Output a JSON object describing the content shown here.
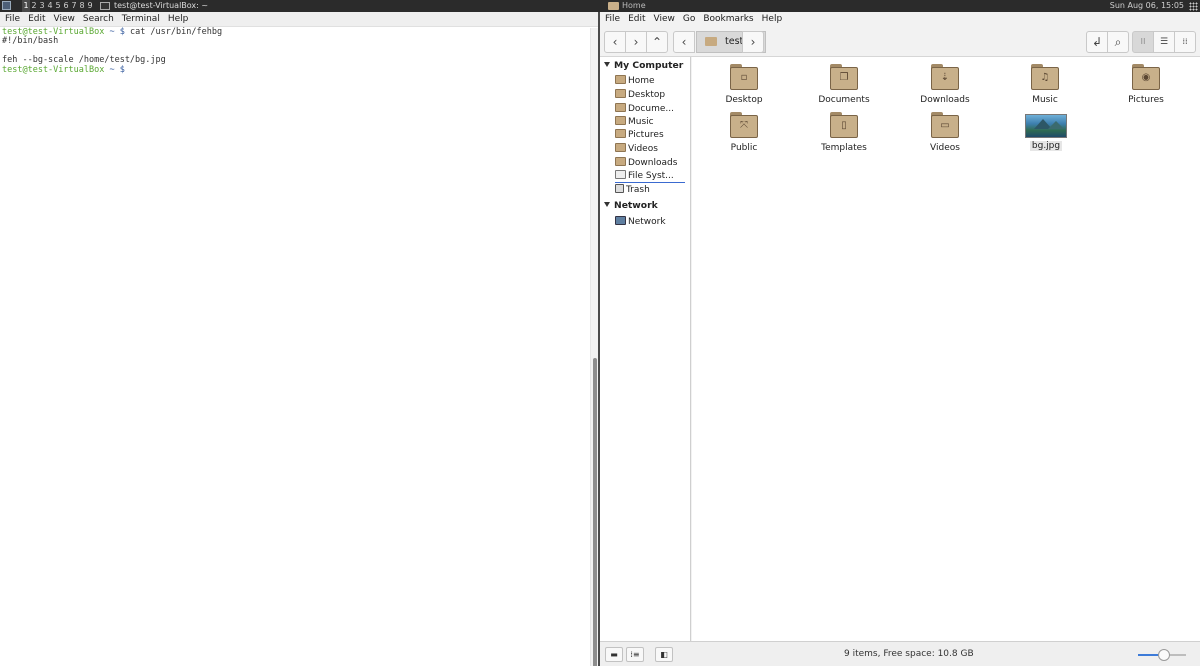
{
  "top_left": {
    "workspaces": [
      "1",
      "2",
      "3",
      "4",
      "5",
      "6",
      "7",
      "8",
      "9"
    ],
    "active_workspace": "1",
    "task_title": "test@test-VirtualBox: ~"
  },
  "top_right": {
    "task_title": "Home",
    "clock": "Sun Aug 06, 15:05"
  },
  "terminal": {
    "menu": [
      "File",
      "Edit",
      "View",
      "Search",
      "Terminal",
      "Help"
    ],
    "lines": [
      {
        "prompt": "test@test-VirtualBox",
        "sym": " ~ $",
        "text": " cat /usr/bin/fehbg"
      },
      {
        "prompt": "",
        "sym": "",
        "text": "#!/bin/bash"
      },
      {
        "prompt": "",
        "sym": "",
        "text": ""
      },
      {
        "prompt": "",
        "sym": "",
        "text": "feh --bg-scale /home/test/bg.jpg"
      },
      {
        "prompt": "test@test-VirtualBox",
        "sym": " ~ $",
        "text": " "
      }
    ]
  },
  "filemanager": {
    "menu": [
      "File",
      "Edit",
      "View",
      "Go",
      "Bookmarks",
      "Help"
    ],
    "toolbar": {
      "back": "‹",
      "forward": "›",
      "up": "⌃",
      "crumb_prev": "‹",
      "crumb_next": "›",
      "crumb": "test",
      "terminal": "↲",
      "search": "⌕",
      "icon_view": "⁝⁝",
      "list_view": "☰",
      "compact_view": "⁞⁞"
    },
    "sidebar": {
      "computer_head": "My Computer",
      "computer_items": [
        "Home",
        "Desktop",
        "Documents",
        "Music",
        "Pictures",
        "Videos",
        "Downloads",
        "File System",
        "Trash"
      ],
      "computer_items_display": [
        "Home",
        "Desktop",
        "Docume...",
        "Music",
        "Pictures",
        "Videos",
        "Downloads",
        "File Syst...",
        "Trash"
      ],
      "network_head": "Network",
      "network_items": [
        "Network"
      ]
    },
    "files": [
      {
        "name": "Desktop",
        "glyph": "▫"
      },
      {
        "name": "Documents",
        "glyph": "❐"
      },
      {
        "name": "Downloads",
        "glyph": "⇣"
      },
      {
        "name": "Music",
        "glyph": "♫"
      },
      {
        "name": "Pictures",
        "glyph": "◉"
      },
      {
        "name": "Public",
        "glyph": "⤧"
      },
      {
        "name": "Templates",
        "glyph": "▯"
      },
      {
        "name": "Videos",
        "glyph": "▭"
      }
    ],
    "image_file": {
      "name": "bg.jpg"
    },
    "status": {
      "text": "9 items, Free space: 10.8 GB",
      "btn_places": "▬",
      "btn_tree": "⁞≡",
      "btn_toggle": "◧",
      "zoom_level": 0.55
    }
  }
}
